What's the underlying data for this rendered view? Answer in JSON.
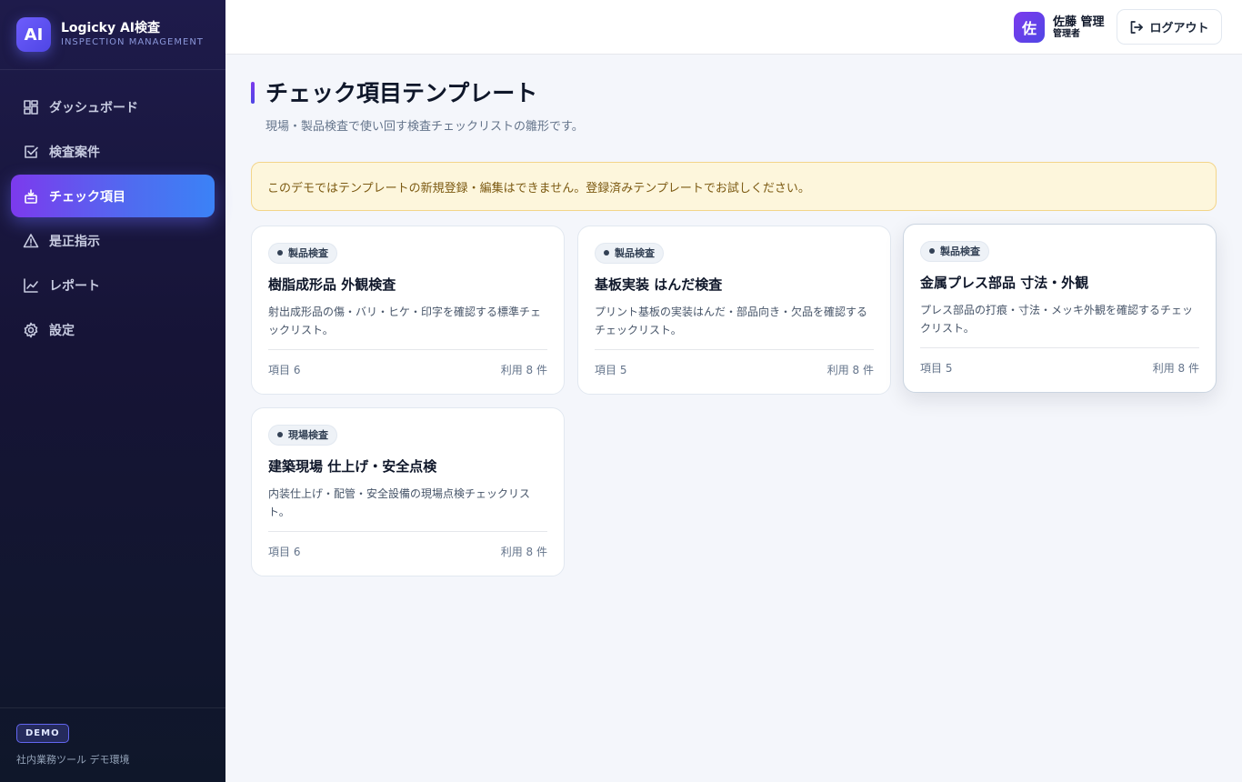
{
  "brand": {
    "logo": "AI",
    "title": "Logicky AI検査",
    "subtitle": "INSPECTION MANAGEMENT"
  },
  "sidebar": {
    "items": [
      {
        "label": "ダッシュボード",
        "icon": "dashboard-icon"
      },
      {
        "label": "検査案件",
        "icon": "checkbox-icon"
      },
      {
        "label": "チェック項目",
        "icon": "template-icon",
        "active": true
      },
      {
        "label": "是正指示",
        "icon": "warning-icon"
      },
      {
        "label": "レポート",
        "icon": "chart-icon"
      },
      {
        "label": "設定",
        "icon": "gear-icon"
      }
    ],
    "footer": {
      "badge": "DEMO",
      "note": "社内業務ツール デモ環境"
    }
  },
  "header": {
    "user": {
      "avatar": "佐",
      "name": "佐藤 管理",
      "role": "管理者"
    },
    "logout_label": "ログアウト"
  },
  "main": {
    "title": "チェック項目テンプレート",
    "subtitle": "現場・製品検査で使い回す検査チェックリストの雛形です。",
    "notice": "このデモではテンプレートの新規登録・編集はできません。登録済みテンプレートでお試しください。",
    "cards": [
      {
        "tag": "製品検査",
        "title": "樹脂成形品 外観検査",
        "desc": "射出成形品の傷・バリ・ヒケ・印字を確認する標準チェックリスト。",
        "items": "項目 6",
        "usage": "利用 8 件"
      },
      {
        "tag": "製品検査",
        "title": "基板実装 はんだ検査",
        "desc": "プリント基板の実装はんだ・部品向き・欠品を確認するチェックリスト。",
        "items": "項目 5",
        "usage": "利用 8 件"
      },
      {
        "tag": "製品検査",
        "title": "金属プレス部品 寸法・外観",
        "desc": "プレス部品の打痕・寸法・メッキ外観を確認するチェックリスト。",
        "items": "項目 5",
        "usage": "利用 8 件"
      },
      {
        "tag": "現場検査",
        "title": "建築現場 仕上げ・安全点検",
        "desc": "内装仕上げ・配管・安全設備の現場点検チェックリスト。",
        "items": "項目 6",
        "usage": "利用 8 件"
      }
    ]
  }
}
